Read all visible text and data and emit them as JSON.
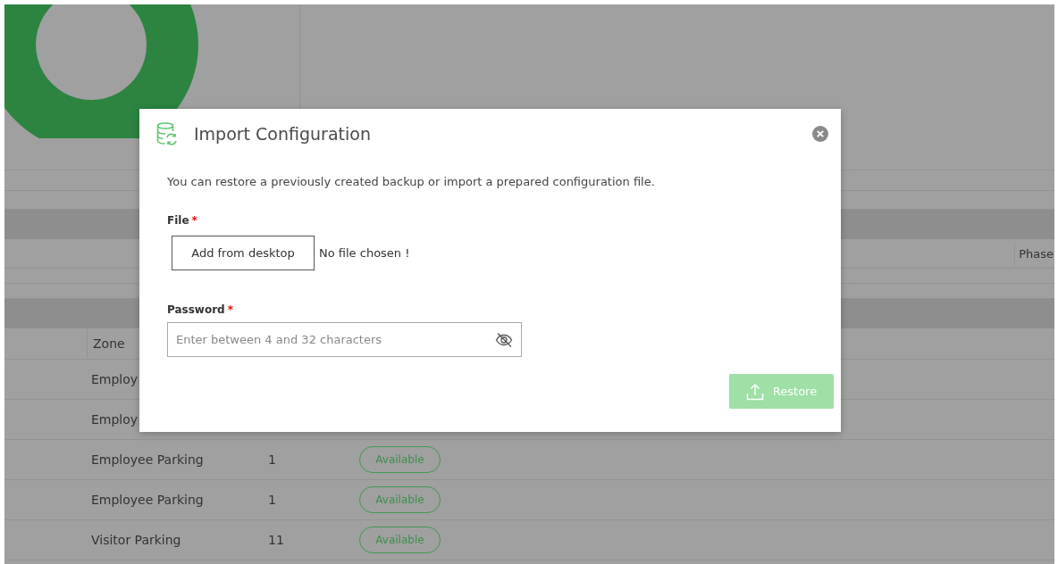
{
  "dashboard": {
    "phase_header": "Phase",
    "table": {
      "zone_header": "Zone",
      "rows": [
        {
          "zone": "Employ"
        },
        {
          "zone": "Employ"
        },
        {
          "zone": "Employee Parking",
          "count": "1",
          "status": "Available"
        },
        {
          "zone": "Employee Parking",
          "count": "1",
          "status": "Available"
        },
        {
          "zone": "Visitor Parking",
          "count": "11",
          "status": "Available"
        }
      ]
    }
  },
  "dialog": {
    "title": "Import Configuration",
    "description": "You can restore a previously created backup or import a prepared configuration file.",
    "file": {
      "label": "File",
      "required_mark": "*",
      "button": "Add from desktop",
      "status": "No file chosen !"
    },
    "password": {
      "label": "Password",
      "required_mark": "*",
      "placeholder": "Enter between 4 and 32 characters"
    },
    "restore_button": {
      "label": "Restore",
      "disabled": true
    }
  }
}
